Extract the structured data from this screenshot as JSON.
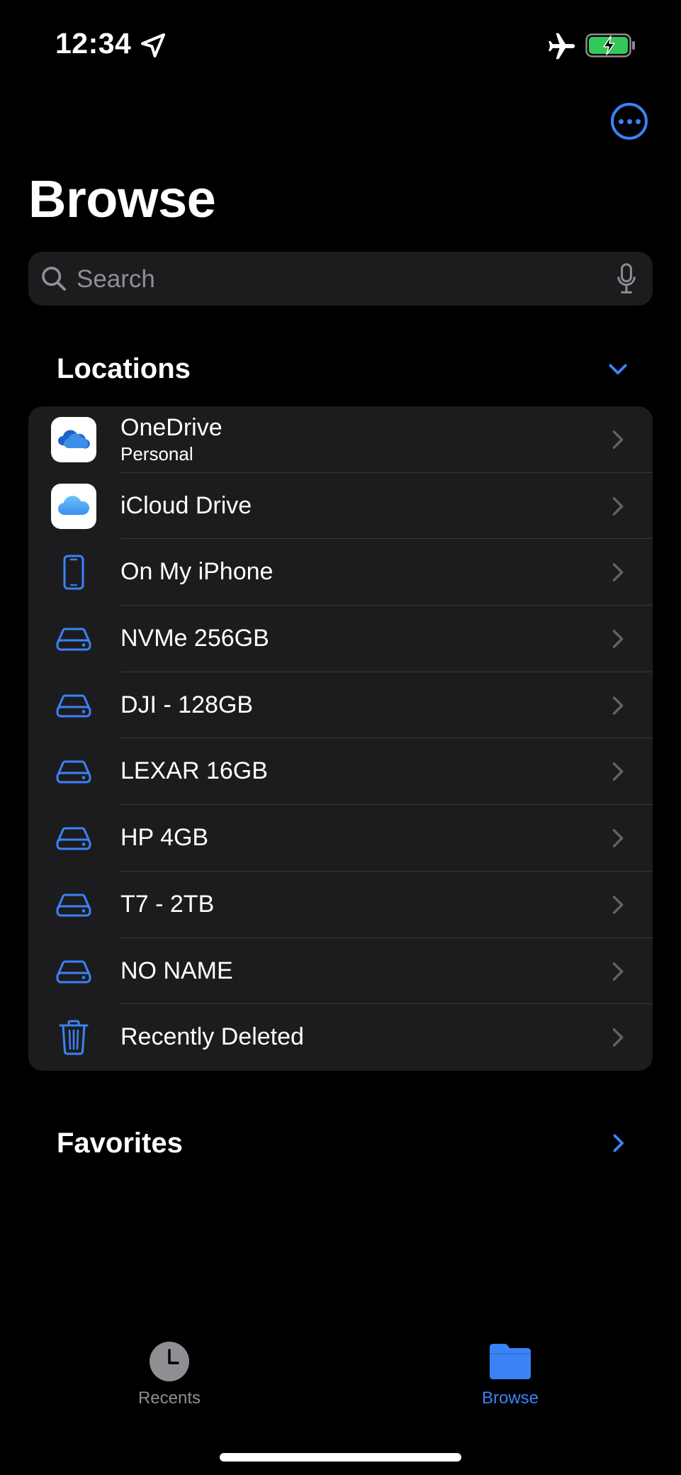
{
  "status_bar": {
    "time": "12:34"
  },
  "header": {
    "title": "Browse"
  },
  "search": {
    "placeholder": "Search"
  },
  "sections": {
    "locations": "Locations",
    "favorites": "Favorites"
  },
  "locations": [
    {
      "label": "OneDrive",
      "sublabel": "Personal",
      "icon": "onedrive-icon"
    },
    {
      "label": "iCloud Drive",
      "icon": "icloud-icon"
    },
    {
      "label": "On My iPhone",
      "icon": "iphone-icon"
    },
    {
      "label": "NVMe 256GB",
      "icon": "external-drive-icon"
    },
    {
      "label": "DJI - 128GB",
      "icon": "external-drive-icon"
    },
    {
      "label": "LEXAR 16GB",
      "icon": "external-drive-icon"
    },
    {
      "label": "HP 4GB",
      "icon": "external-drive-icon"
    },
    {
      "label": "T7 - 2TB",
      "icon": "external-drive-icon"
    },
    {
      "label": "NO NAME",
      "icon": "external-drive-icon"
    },
    {
      "label": "Recently Deleted",
      "icon": "trash-icon"
    }
  ],
  "tabs": {
    "recents": "Recents",
    "browse": "Browse"
  },
  "colors": {
    "accent": "#3b82f6",
    "background": "#000000",
    "cell": "#1c1c1e",
    "inactive": "#8e8e93"
  }
}
